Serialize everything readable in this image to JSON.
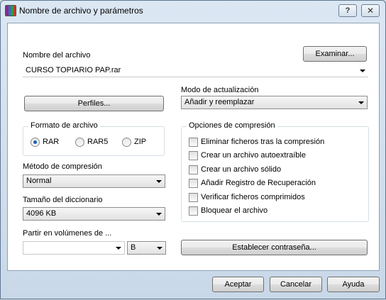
{
  "window": {
    "title": "Nombre de archivo y parámetros",
    "help_glyph": "?",
    "close_glyph": "✕"
  },
  "archive": {
    "label": "Nombre del archivo",
    "value": "CURSO TOPIARIO PAP.rar",
    "browse_label": "Examinar..."
  },
  "profiles": {
    "label": "Perfiles..."
  },
  "update_mode": {
    "label": "Modo de actualización",
    "value": "Añadir y reemplazar"
  },
  "format": {
    "title": "Formato de archivo",
    "options": [
      "RAR",
      "RAR5",
      "ZIP"
    ],
    "selected": "RAR"
  },
  "compression_method": {
    "label": "Método de compresión",
    "value": "Normal"
  },
  "dictionary": {
    "label": "Tamaño del diccionario",
    "value": "4096 KB"
  },
  "split": {
    "label": "Partir en volúmenes de ...",
    "value": "",
    "unit": "B"
  },
  "options": {
    "title": "Opciones de compresión",
    "items": [
      {
        "label": "Eliminar ficheros tras la compresión",
        "checked": false
      },
      {
        "label": "Crear un archivo autoextraíble",
        "checked": false
      },
      {
        "label": "Crear un archivo sólido",
        "checked": false
      },
      {
        "label": "Añadir Registro de Recuperación",
        "checked": false
      },
      {
        "label": "Verificar ficheros comprimidos",
        "checked": false
      },
      {
        "label": "Bloquear el archivo",
        "checked": false
      }
    ]
  },
  "password": {
    "label": "Establecer contraseña..."
  },
  "footer": {
    "ok_label": "Aceptar",
    "cancel_label": "Cancelar",
    "help_label": "Ayuda"
  }
}
